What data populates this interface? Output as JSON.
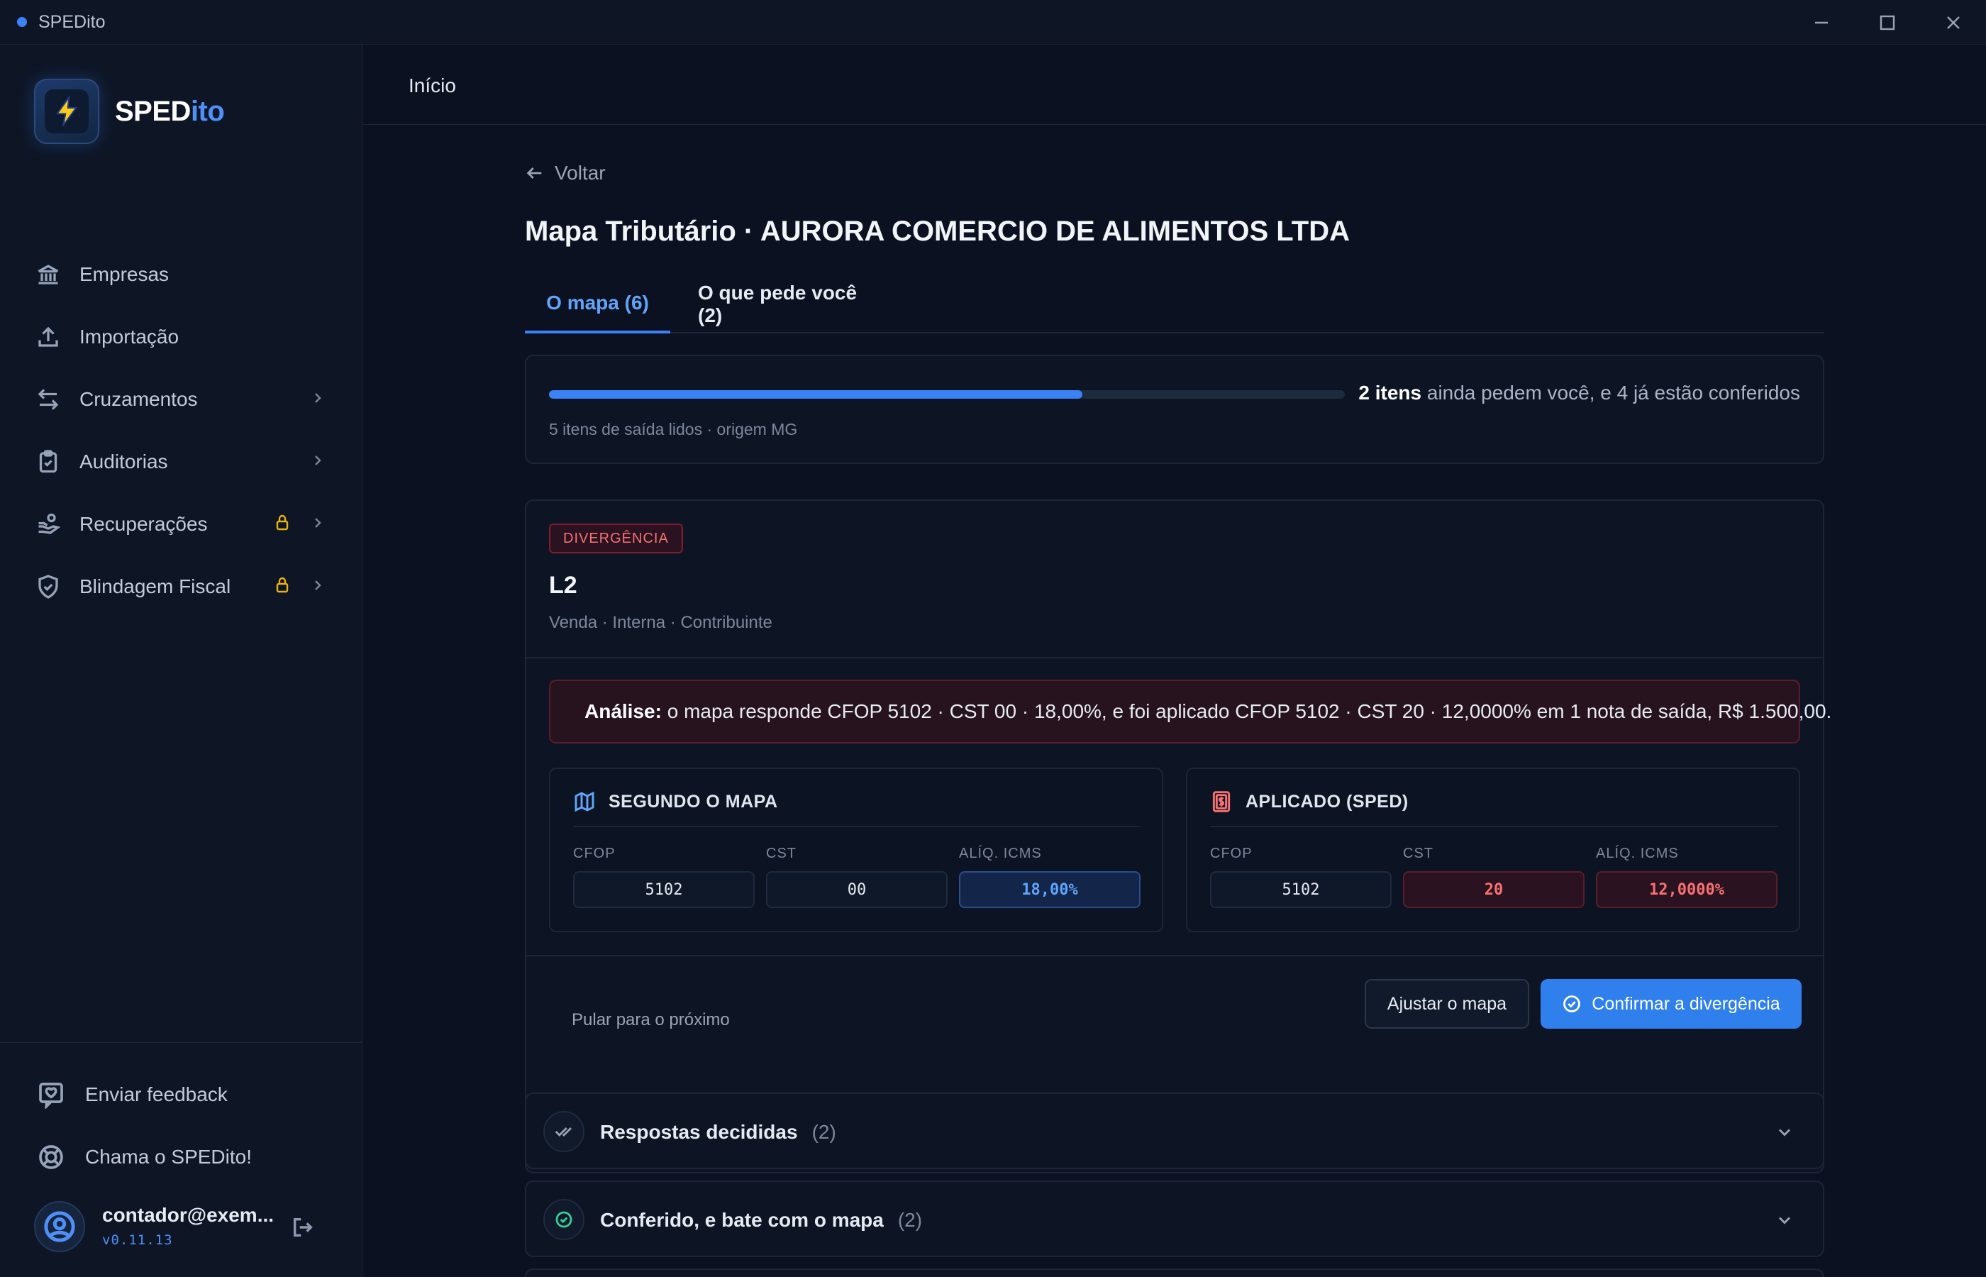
{
  "window": {
    "title": "SPEDito"
  },
  "brand": {
    "name_main": "SPED",
    "name_accent": "ito"
  },
  "sidebar": {
    "items": [
      {
        "label": "Empresas"
      },
      {
        "label": "Importação"
      },
      {
        "label": "Cruzamentos"
      },
      {
        "label": "Auditorias"
      },
      {
        "label": "Recuperações"
      },
      {
        "label": "Blindagem Fiscal"
      }
    ],
    "feedback_label": "Enviar feedback",
    "help_label": "Chama o SPEDito!",
    "user_email": "contador@exem...",
    "version": "v0.11.13"
  },
  "topbar": {
    "crumb": "Início"
  },
  "page": {
    "back_label": "Voltar",
    "title": "Mapa Tributário · AURORA COMERCIO DE ALIMENTOS LTDA",
    "tabs": [
      {
        "label": "O mapa (6)"
      },
      {
        "label": "O que pede você (2)"
      }
    ]
  },
  "progress": {
    "fraction": 0.67,
    "bold": "2 itens",
    "rest": " ainda pedem você, e 4 já estão conferidos",
    "sub": "5 itens de saída lidos · origem MG"
  },
  "item": {
    "badge": "DIVERGÊNCIA",
    "code": "L2",
    "subtitle": "Venda · Interna · Contribuinte",
    "alert_bold": "Análise:",
    "alert_text": " o mapa responde CFOP 5102 · CST 00 · 18,00%, e foi aplicado CFOP 5102 · CST 20 · 12,0000% em 1 nota de saída, R$ 1.500,00.",
    "map_panel": {
      "title": "SEGUNDO O MAPA",
      "labels": [
        "CFOP",
        "CST",
        "ALÍQ. ICMS"
      ],
      "values": [
        "5102",
        "00",
        "18,00%"
      ]
    },
    "sped_panel": {
      "title": "APLICADO (SPED)",
      "labels": [
        "CFOP",
        "CST",
        "ALÍQ. ICMS"
      ],
      "values": [
        "5102",
        "20",
        "12,0000%"
      ]
    },
    "skip_label": "Pular para o próximo",
    "adjust_label": "Ajustar o mapa",
    "confirm_label": "Confirmar a divergência"
  },
  "sections": [
    {
      "label": "Respostas decididas",
      "count": "(2)"
    },
    {
      "label": "Conferido, e bate com o mapa",
      "count": "(2)"
    }
  ],
  "colors": {
    "accent": "#3b82f6",
    "danger": "#f87171",
    "lock": "#eab308"
  }
}
